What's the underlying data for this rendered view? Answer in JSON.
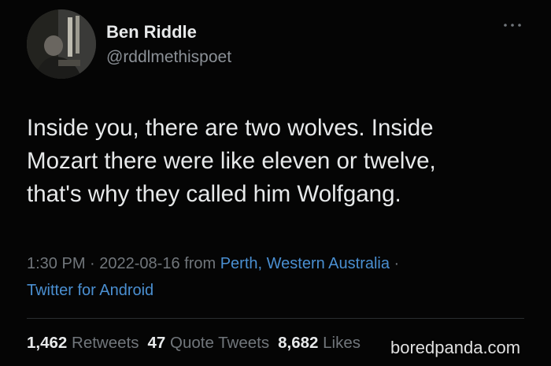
{
  "tweet": {
    "author": {
      "name": "Ben Riddle",
      "handle": "@rddlmethispoet"
    },
    "text_lines": [
      "Inside you, there are two wolves. Inside",
      "Mozart there were like eleven or twelve,",
      "that's why they called him Wolfgang."
    ],
    "meta": {
      "time": "1:30 PM",
      "sep1": " · ",
      "date": "2022-08-16",
      "from": " from ",
      "location": "Perth, Western Australia",
      "sep2": " ·",
      "client": "Twitter for Android"
    },
    "stats": {
      "retweets_count": "1,462",
      "retweets_label": "Retweets",
      "quotes_count": "47",
      "quotes_label": "Quote Tweets",
      "likes_count": "8,682",
      "likes_label": "Likes"
    },
    "more_icon": "more-horizontal-icon"
  },
  "watermark": "boredpanda.com",
  "colors": {
    "background": "#000000",
    "text": "#e7e9ea",
    "secondary": "#71767b",
    "link": "#4a8fd1"
  }
}
